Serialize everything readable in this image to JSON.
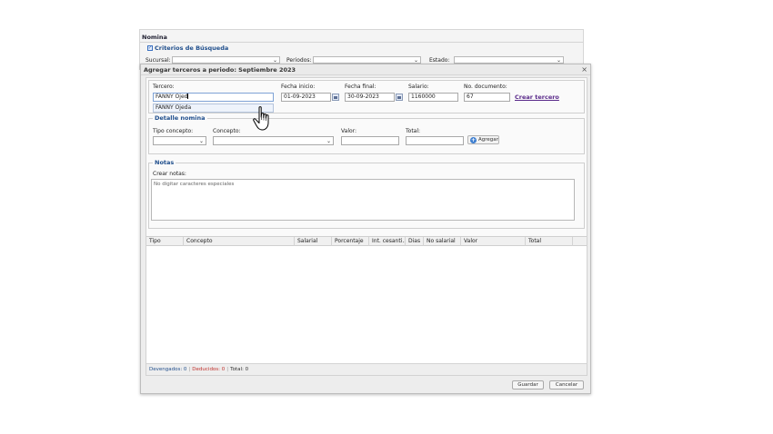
{
  "background_window": {
    "title": "Nomina",
    "criteria_legend": "Criterios de Búsqueda",
    "sucursal_label": "Sucursal:",
    "periodos_label": "Periodos:",
    "estado_label": "Estado:"
  },
  "dialog": {
    "title": "Agregar terceros a periodo: Septiembre 2023",
    "tercero": {
      "label": "Tercero:",
      "value": "FANNY  Ojed",
      "suggestion": "FANNY Ojeda"
    },
    "fecha_inicio": {
      "label": "Fecha inicio:",
      "value": "01-09-2023"
    },
    "fecha_final": {
      "label": "Fecha final:",
      "value": "30-09-2023"
    },
    "salario": {
      "label": "Salario:",
      "value": "1160000"
    },
    "no_documento": {
      "label": "No. documento:",
      "value": "67"
    },
    "crear_tercero_link": "Crear tercero",
    "detalle": {
      "legend": "Detalle nomina",
      "tipo_concepto_label": "Tipo concepto:",
      "concepto_label": "Concepto:",
      "valor_label": "Valor:",
      "total_label": "Total:",
      "agregar_button": "Agregar"
    },
    "notas": {
      "legend": "Notas",
      "crear_label": "Crear notas:",
      "placeholder": "No digitar caracteres especiales"
    },
    "grid_columns": [
      "Tipo",
      "Concepto",
      "Salarial",
      "Porcentaje",
      "Int. cesanti...",
      "Dias",
      "No salarial",
      "Valor",
      "Total"
    ],
    "footer": {
      "devengados": "Devengados: 0",
      "deducidos": "Deducidos: 0",
      "total": "Total: 0"
    },
    "guardar_button": "Guardar",
    "cancelar_button": "Cancelar"
  },
  "icons": {
    "close": "close-icon",
    "calendar": "calendar-icon",
    "dropdown": "chevron-down-icon",
    "add": "plus-circle-icon",
    "cursor": "hand-pointer-icon"
  }
}
